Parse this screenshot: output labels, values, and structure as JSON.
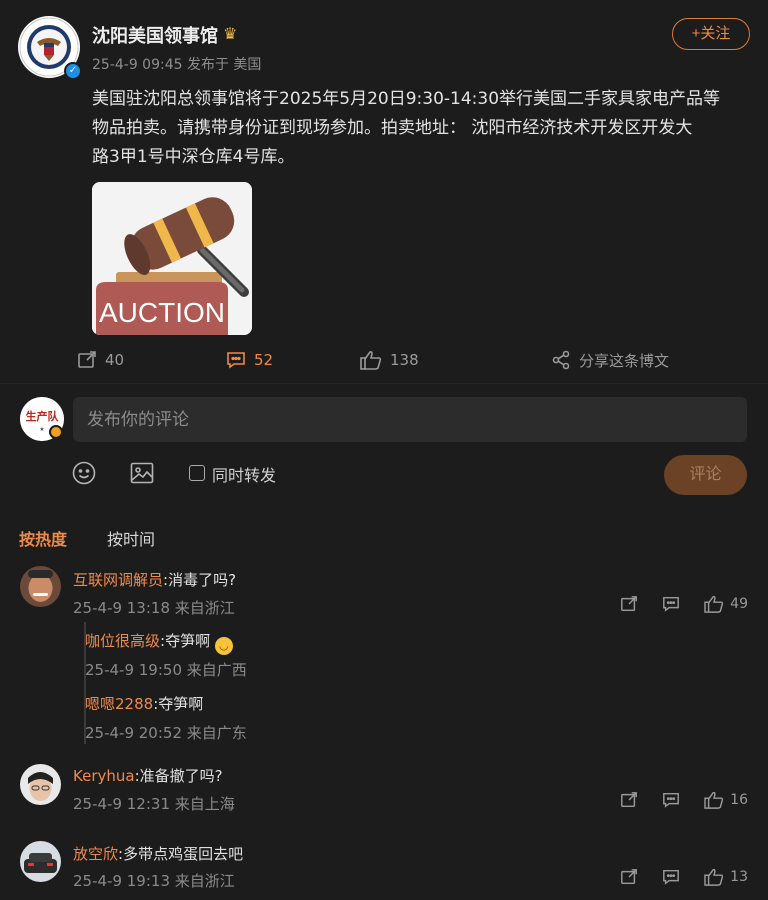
{
  "post": {
    "author": "沈阳美国领事馆",
    "date": "25-4-9 09:45",
    "location": "发布于 美国",
    "follow_label": "+关注",
    "text_line1": "美国驻沈阳总领事馆将于2025年5月20日9:30-14:30举行美国二手家具家电产品等",
    "text_line2": "物品拍卖。请携带身份证到现场参加。拍卖地址： 沈阳市经济技术开发区开发大",
    "text_line3": "路3甲1号中深仓库4号库。",
    "image_caption": "AUCTION"
  },
  "actions": {
    "repost_count": "40",
    "comment_count": "52",
    "like_count": "138",
    "share_label": "分享这条博文"
  },
  "composer": {
    "placeholder": "发布你的评论",
    "my_avatar_text": "生产队",
    "repost_label": "同时转发",
    "submit_label": "评论"
  },
  "sort": {
    "hot": "按热度",
    "time": "按时间"
  },
  "comments": [
    {
      "user": "互联网调解员",
      "text": ":消毒了吗?",
      "meta": "25-4-9 13:18 来自浙江",
      "likes": "49",
      "replies": [
        {
          "user": "咖位很高级",
          "text": ":夺笋啊",
          "meta": "25-4-9 19:50 来自广西"
        },
        {
          "user": "嗯嗯2288",
          "text": ":夺笋啊",
          "meta": "25-4-9 20:52 来自广东"
        }
      ]
    },
    {
      "user": "Keryhua",
      "text": ":准备撤了吗?",
      "meta": "25-4-9 12:31 来自上海",
      "likes": "16"
    },
    {
      "user": "放空欣",
      "text": ":多带点鸡蛋回去吧",
      "meta": "25-4-9 19:13 来自浙江",
      "likes": "13"
    }
  ],
  "colors": {
    "accent": "#ee8a45",
    "background": "#1c1c1c",
    "username": "#f08a4b"
  }
}
